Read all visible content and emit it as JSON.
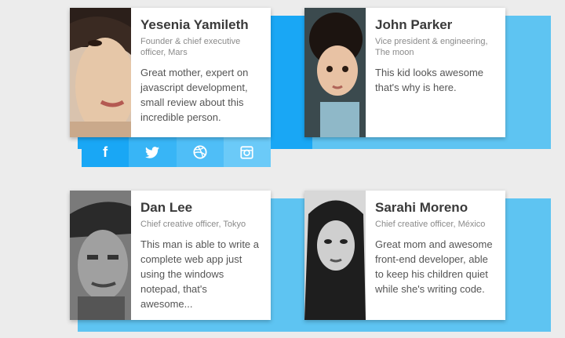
{
  "cards": [
    {
      "name": "Yesenia Yamileth",
      "role": "Founder & chief executive officer, Mars",
      "bio": "Great mother, expert on javascript development, small review about this incredible person.",
      "social": [
        "f",
        "twitter-icon",
        "dribbble-icon",
        "instagram-icon"
      ]
    },
    {
      "name": "John Parker",
      "role": "Vice president & engineering, The moon",
      "bio": "This kid looks awesome that's why is here."
    },
    {
      "name": "Dan Lee",
      "role": "Chief creative officer, Tokyo",
      "bio": "This man is able to write a complete web app just using the windows notepad, that's awesome..."
    },
    {
      "name": "Sarahi Moreno",
      "role": "Chief creative officer, México",
      "bio": "Great mom and awesome front-end developer, able to keep his children quiet while she's writing code."
    }
  ],
  "colors": {
    "accent": "#19a7f5",
    "shadow": "#5ec4f2",
    "background": "#ececec"
  }
}
